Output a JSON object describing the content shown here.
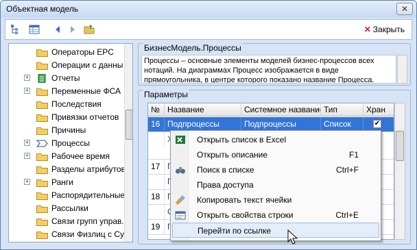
{
  "window": {
    "title": "Объектная модель"
  },
  "toolbar": {
    "close_label": "Закрыть"
  },
  "tree": {
    "items": [
      {
        "label": "Операторы EPC",
        "expand": ""
      },
      {
        "label": "Операции с данны",
        "expand": ""
      },
      {
        "label": "Отчеты",
        "expand": "+"
      },
      {
        "label": "Переменные ФСА",
        "expand": "+"
      },
      {
        "label": "Последствия",
        "expand": ""
      },
      {
        "label": "Привязки отчетов",
        "expand": ""
      },
      {
        "label": "Причины",
        "expand": ""
      },
      {
        "label": "Процессы",
        "expand": "+"
      },
      {
        "label": "Рабочее время",
        "expand": "+"
      },
      {
        "label": "Разделы атрибутов",
        "expand": ""
      },
      {
        "label": "Ранги",
        "expand": "+"
      },
      {
        "label": "Распорядительные",
        "expand": ""
      },
      {
        "label": "Рассылки",
        "expand": ""
      },
      {
        "label": "Связи групп управ.",
        "expand": ""
      },
      {
        "label": "Связи Физлиц с Су",
        "expand": ""
      }
    ]
  },
  "description": {
    "legend": "БизнесМодель.Процессы",
    "text": "Процессы – основные элементы моделей бизнес-процессов всех нотаций. На диаграммах Процесс изображается в виде прямоугольника, в центре которого показано название Процесса."
  },
  "params": {
    "legend": "Параметры",
    "columns": [
      "№",
      "Название",
      "Системное название",
      "Тип",
      "Хран"
    ],
    "rows": [
      {
        "num": "16",
        "name": "Подпроцессы",
        "sys": "Подпроцессы",
        "type": "Список",
        "stored": "✔"
      },
      {
        "num": "",
        "name": "Х п э у",
        "sys": "",
        "type": "",
        "stored": ""
      },
      {
        "num": "17",
        "name": "П",
        "sys": "",
        "type": "",
        "stored": ""
      },
      {
        "num": "",
        "name": "П",
        "sys": "",
        "type": "",
        "stored": ""
      },
      {
        "num": "18",
        "name": "П",
        "sys": "",
        "type": "",
        "stored": ""
      },
      {
        "num": "",
        "name": "С",
        "sys": "",
        "type": "",
        "stored": ""
      },
      {
        "num": "19",
        "name": "П",
        "sys": "",
        "type": "",
        "stored": ""
      }
    ]
  },
  "context_menu": {
    "items": [
      {
        "label": "Открыть список в Excel",
        "shortcut": "",
        "icon": "excel-icon"
      },
      {
        "label": "Открыть описание",
        "shortcut": "F1",
        "icon": ""
      },
      {
        "label": "Поиск в списке",
        "shortcut": "Ctrl+F",
        "icon": "binoculars-icon"
      },
      {
        "label": "Права доступа",
        "shortcut": "",
        "icon": ""
      },
      {
        "label": "Копировать текст ячейки",
        "shortcut": "",
        "icon": "brush-icon"
      },
      {
        "label": "Открыть свойства строки",
        "shortcut": "Ctrl+E",
        "icon": "properties-icon"
      },
      {
        "label": "Перейти по ссылке",
        "shortcut": "",
        "icon": ""
      }
    ]
  }
}
